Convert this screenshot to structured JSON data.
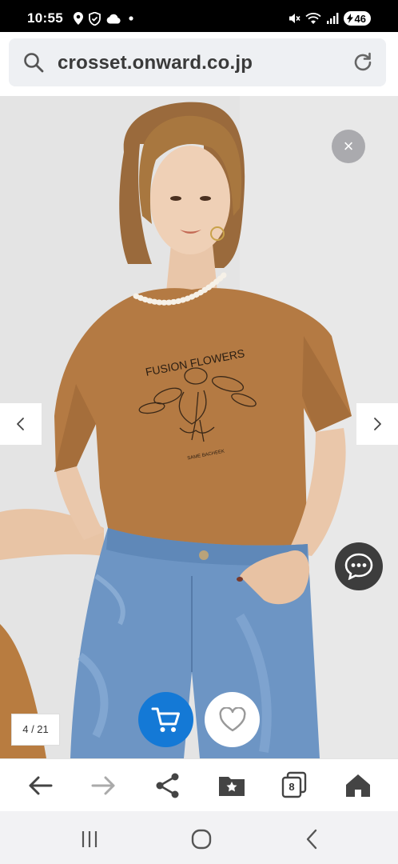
{
  "status_bar": {
    "time": "10:55",
    "battery_level": "46",
    "left_icons": [
      "location-icon",
      "shield-icon",
      "cloud-icon",
      "dot-icon"
    ],
    "right_icons": [
      "mute-icon",
      "wifi-icon",
      "signal-icon",
      "battery-charging-icon"
    ]
  },
  "address_bar": {
    "url": "crosset.onward.co.jp"
  },
  "gallery": {
    "counter": "4 / 21",
    "close_symbol": "×",
    "print_title": "FUSION FLOWERS",
    "print_subtitle": "SAME BACHEEK"
  },
  "toolbar": {
    "tabs_count": "8",
    "items": [
      "back-icon",
      "forward-icon",
      "share-icon",
      "bookmark-icon",
      "tabs-icon",
      "home-icon"
    ]
  },
  "colors": {
    "accent_blue": "#1479d6",
    "shirt": "#b57c45",
    "jeans": "#6f96c3",
    "chat_bg": "#3d3d3d"
  }
}
